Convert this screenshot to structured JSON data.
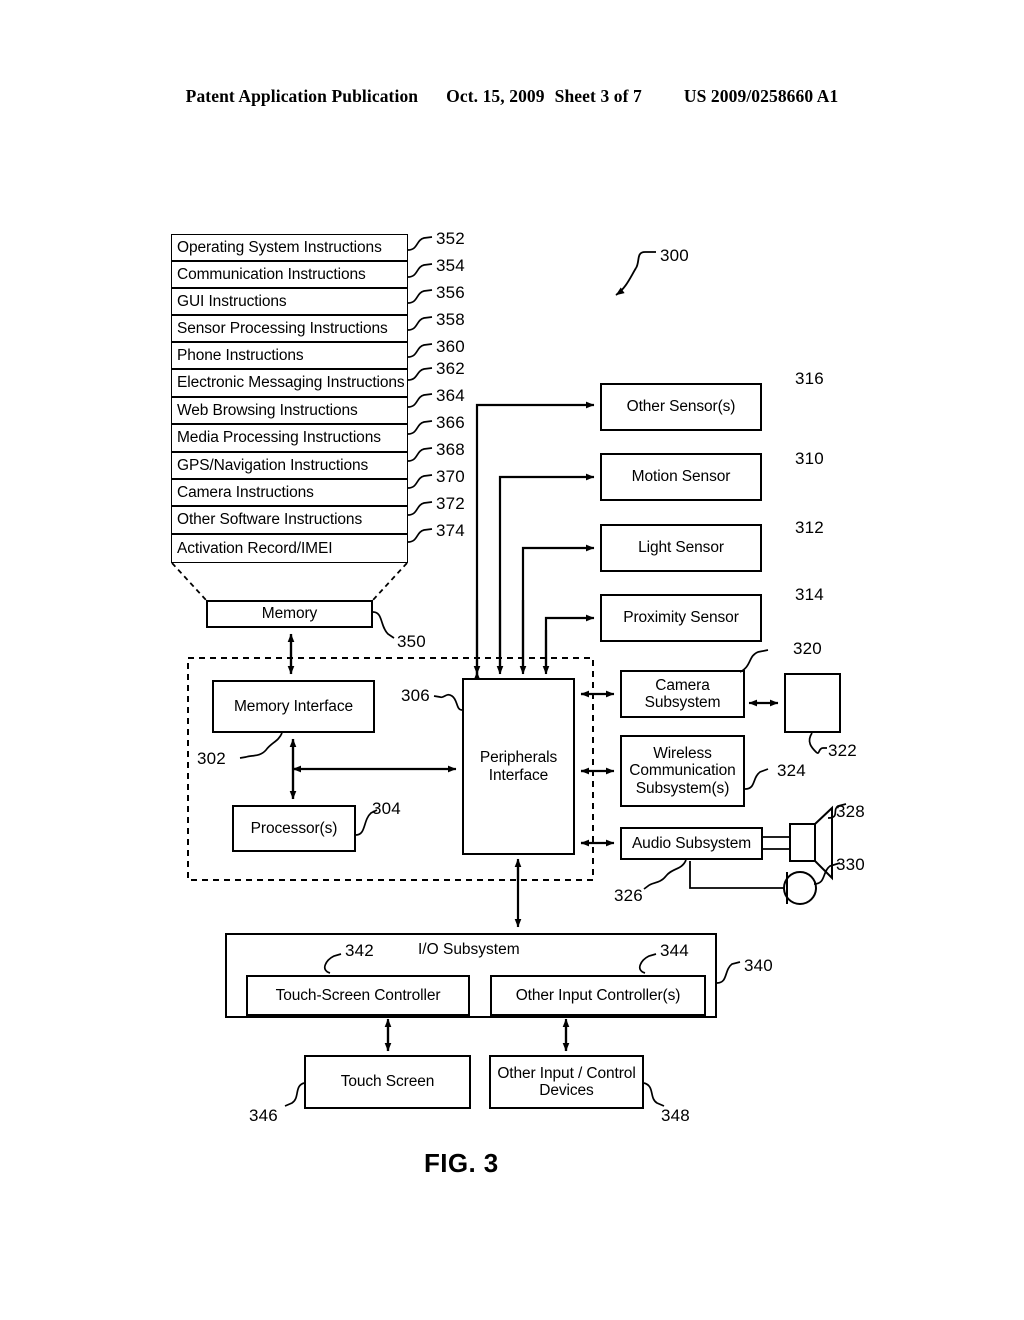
{
  "header": {
    "publication": "Patent Application Publication",
    "date": "Oct. 15, 2009",
    "sheet": "Sheet 3 of 7",
    "patent_number": "US 2009/0258660 A1"
  },
  "figure": {
    "caption": "FIG. 3",
    "system_ref": "300"
  },
  "memory_instructions": {
    "rows": [
      {
        "label": "Operating System Instructions",
        "ref": "352"
      },
      {
        "label": "Communication Instructions",
        "ref": "354"
      },
      {
        "label": "GUI Instructions",
        "ref": "356"
      },
      {
        "label": "Sensor Processing Instructions",
        "ref": "358"
      },
      {
        "label": "Phone Instructions",
        "ref": "360"
      },
      {
        "label": "Electronic Messaging Instructions",
        "ref": "362"
      },
      {
        "label": "Web Browsing Instructions",
        "ref": "364"
      },
      {
        "label": "Media Processing Instructions",
        "ref": "366"
      },
      {
        "label": "GPS/Navigation Instructions",
        "ref": "368"
      },
      {
        "label": "Camera Instructions",
        "ref": "370"
      },
      {
        "label": "Other Software Instructions",
        "ref": "372"
      },
      {
        "label": "Activation Record/IMEI",
        "ref": "374"
      }
    ]
  },
  "core": {
    "memory": {
      "label": "Memory",
      "ref": "350"
    },
    "memory_interface": {
      "label": "Memory Interface",
      "ref": "302"
    },
    "processors": {
      "label": "Processor(s)",
      "ref": "304"
    },
    "peripherals_interface": {
      "label": "Peripherals Interface",
      "line1": "Peripherals",
      "line2": "Interface",
      "ref": "306"
    }
  },
  "sensors": [
    {
      "label": "Other Sensor(s)",
      "ref": "316"
    },
    {
      "label": "Motion Sensor",
      "ref": "310"
    },
    {
      "label": "Light Sensor",
      "ref": "312"
    },
    {
      "label": "Proximity Sensor",
      "ref": "314"
    }
  ],
  "subsystems": {
    "camera": {
      "line1": "Camera",
      "line2": "Subsystem",
      "ref": "320"
    },
    "optical_sensor": {
      "label": "",
      "ref": "322"
    },
    "wireless": {
      "line1": "Wireless",
      "line2": "Communication",
      "line3": "Subsystem(s)",
      "ref": "324"
    },
    "audio": {
      "label": "Audio Subsystem",
      "ref": "326"
    },
    "speaker": {
      "ref": "328"
    },
    "microphone": {
      "ref": "330"
    }
  },
  "io_subsystem": {
    "title": "I/O Subsystem",
    "ref": "340",
    "touch_screen_controller": {
      "label": "Touch-Screen Controller",
      "ref": "342"
    },
    "other_input_controllers": {
      "label": "Other Input Controller(s)",
      "ref": "344"
    },
    "touch_screen": {
      "label": "Touch Screen",
      "ref": "346"
    },
    "other_input_devices": {
      "line1": "Other Input / Control",
      "line2": "Devices",
      "ref": "348"
    }
  }
}
